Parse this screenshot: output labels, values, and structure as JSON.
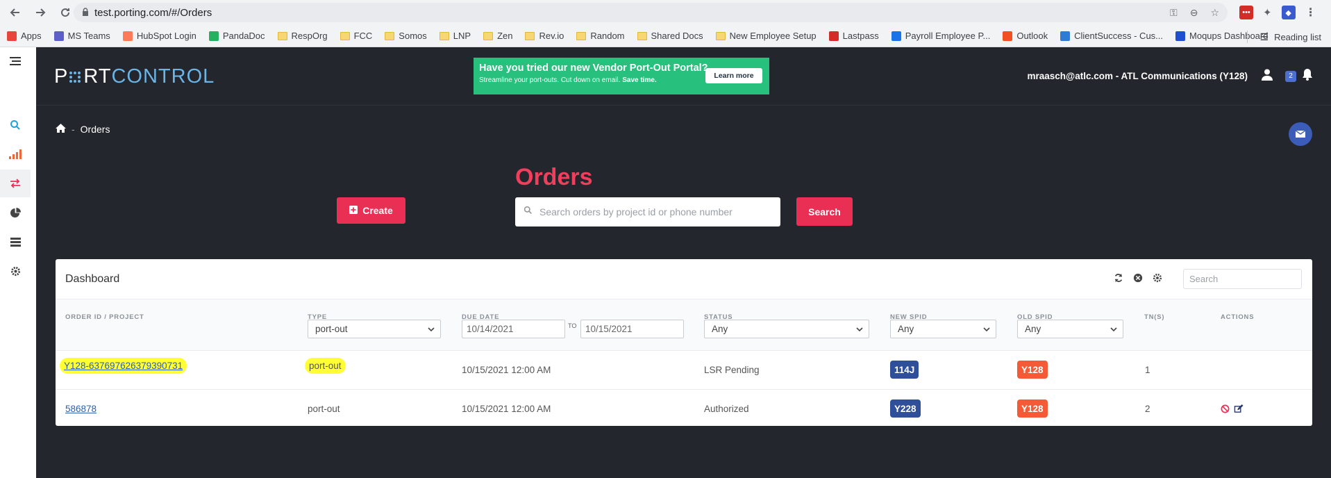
{
  "browser": {
    "url": "test.porting.com/#/Orders",
    "bookmarks": [
      {
        "label": "Apps",
        "icon": "apps-grid-icon",
        "color": "#e8453c"
      },
      {
        "label": "MS Teams",
        "icon": "teams-icon",
        "color": "#5b5fc7"
      },
      {
        "label": "HubSpot Login",
        "icon": "hubspot-icon",
        "color": "#ff7a59"
      },
      {
        "label": "PandaDoc",
        "icon": "pandadoc-icon",
        "color": "#25b15f"
      },
      {
        "label": "RespOrg",
        "icon": "folder-icon"
      },
      {
        "label": "FCC",
        "icon": "folder-icon"
      },
      {
        "label": "Somos",
        "icon": "folder-icon"
      },
      {
        "label": "LNP",
        "icon": "folder-icon"
      },
      {
        "label": "Zen",
        "icon": "folder-icon"
      },
      {
        "label": "Rev.io",
        "icon": "folder-icon"
      },
      {
        "label": "Random",
        "icon": "folder-icon"
      },
      {
        "label": "Shared Docs",
        "icon": "folder-icon"
      },
      {
        "label": "New Employee Setup",
        "icon": "folder-icon"
      },
      {
        "label": "Lastpass",
        "icon": "lastpass-icon",
        "color": "#d32d27"
      },
      {
        "label": "Payroll Employee P...",
        "icon": "payroll-icon",
        "color": "#1a73e8"
      },
      {
        "label": "Outlook",
        "icon": "outlook-icon",
        "color": "#f25022"
      },
      {
        "label": "ClientSuccess - Cus...",
        "icon": "clientsuccess-icon",
        "color": "#2e7bd6"
      },
      {
        "label": "Moqups Dashboard",
        "icon": "moqups-icon",
        "color": "#1f4fd1"
      }
    ],
    "reading_list": "Reading list"
  },
  "header": {
    "logo_part1": "P",
    "logo_part1b": "RT",
    "logo_part2": "CONTROL",
    "banner_title": "Have you tried our new Vendor Port-Out Portal?",
    "banner_sub": "Streamline your port-outs. Cut down on email.",
    "banner_sub_bold": "Save time.",
    "learn_more": "Learn more",
    "user": "mraasch@atlc.com - ATL Communications (Y128)",
    "notif_count": "2"
  },
  "breadcrumb": {
    "page": "Orders"
  },
  "orders": {
    "title": "Orders",
    "create_label": "Create",
    "search_placeholder": "Search orders by project id or phone number",
    "search_label": "Search"
  },
  "dashboard": {
    "title": "Dashboard",
    "search_placeholder": "Search",
    "columns": {
      "order": "ORDER ID / PROJECT",
      "type": "TYPE",
      "due": "DUE DATE",
      "status": "STATUS",
      "new_spid": "NEW SPID",
      "old_spid": "OLD SPID",
      "tns": "TN(S)",
      "actions": "ACTIONS"
    },
    "filters": {
      "type": "port-out",
      "due_from": "10/14/2021",
      "to": "TO",
      "due_to": "10/15/2021",
      "status": "Any",
      "new_spid": "Any",
      "old_spid": "Any"
    },
    "rows": [
      {
        "order": "Y128-637697626379390731",
        "type": "port-out",
        "due": "10/15/2021 12:00 AM",
        "status": "LSR Pending",
        "new_spid": "114J",
        "old_spid": "Y128",
        "tns": "1"
      },
      {
        "order": "586878",
        "type": "port-out",
        "due": "10/15/2021 12:00 AM",
        "status": "Authorized",
        "new_spid": "Y228",
        "old_spid": "Y128",
        "tns": "2"
      }
    ]
  },
  "colors": {
    "accent": "#ea2f55",
    "banner": "#28c07d",
    "spid_blue": "#2f4f9b",
    "spid_orange": "#f45a36",
    "highlight": "#ffff33"
  }
}
